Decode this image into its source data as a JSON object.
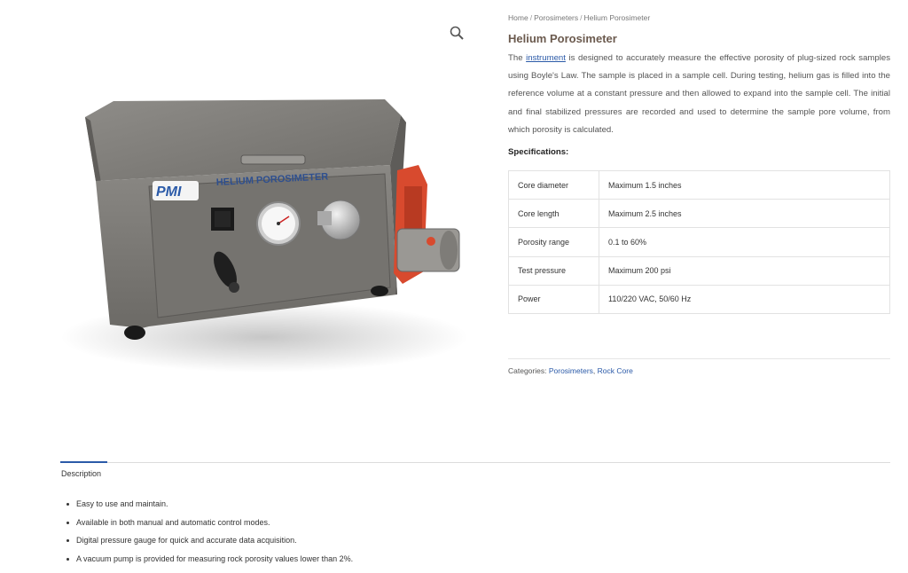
{
  "breadcrumb": {
    "home": "Home",
    "category": "Porosimeters",
    "current": "Helium Porosimeter",
    "separator": "/"
  },
  "product": {
    "title": "Helium Porosimeter",
    "desc_before": "The ",
    "desc_link": "instrument",
    "desc_after": " is designed to accurately measure the effective porosity of plug-sized rock samples using Boyle's Law. The sample is placed in a sample cell. During testing, helium gas is filled into the reference volume at a constant pressure and then allowed to expand into the sample cell. The initial and final stabilized pressures are recorded and used to determine the sample pore volume, from which porosity is calculated.",
    "image_label": "HELIUM POROSIMETER",
    "image_logo": "PMI",
    "zoom_icon": "magnifier-icon"
  },
  "specs": {
    "heading": "Specifications:",
    "rows": [
      {
        "label": "Core diameter",
        "value": "Maximum 1.5 inches"
      },
      {
        "label": "Core length",
        "value": "Maximum 2.5 inches"
      },
      {
        "label": "Porosity range",
        "value": "0.1 to 60%"
      },
      {
        "label": "Test pressure",
        "value": "Maximum 200 psi"
      },
      {
        "label": "Power",
        "value": "110/220 VAC, 50/60 Hz"
      }
    ]
  },
  "categories": {
    "label": "Categories:",
    "items": [
      "Porosimeters",
      "Rock Core"
    ],
    "separator": ","
  },
  "tabs": {
    "active": "Description"
  },
  "features": [
    "Easy to use and maintain.",
    "Available in both manual and automatic control modes.",
    "Digital pressure gauge for quick and accurate data acquisition.",
    "A vacuum pump is provided for measuring rock porosity values lower than 2%."
  ],
  "colors": {
    "link": "#2b5aa8",
    "title": "#6b5a4e",
    "cabinet": "#7c7a76",
    "pump": "#d84a2e"
  }
}
